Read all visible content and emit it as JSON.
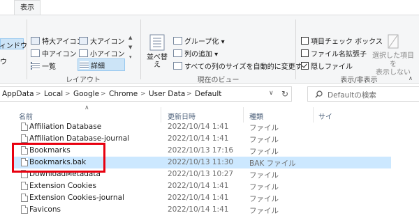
{
  "tabs": {
    "view": "表示"
  },
  "layout_group": {
    "items": [
      {
        "label": "特大アイコン",
        "icon": "extra-large-icons-icon"
      },
      {
        "label": "大アイコン",
        "icon": "large-icons-icon"
      },
      {
        "label": "中アイコン",
        "icon": "medium-icons-icon"
      },
      {
        "label": "小アイコン",
        "icon": "small-icons-icon"
      },
      {
        "label": "一覧",
        "icon": "list-view-icon"
      },
      {
        "label": "詳細",
        "icon": "details-view-icon"
      }
    ],
    "group_label": "レイアウト",
    "left_partial_top": "ィンドウ",
    "left_partial_bottom": "ウ"
  },
  "current_view_group": {
    "sort_label_1": "並べ替",
    "sort_label_2": "え",
    "group_by": "グループ化 ▾",
    "add_column": "列の追加 ▾",
    "fit_columns": "すべての列のサイズを自動的に変更する",
    "group_label": "現在のビュー"
  },
  "show_hide_group": {
    "item_checkboxes": "項目チェック ボックス",
    "file_extensions": "ファイル名拡張子",
    "hidden_files": "隠しファイル",
    "item_checkboxes_checked": false,
    "file_extensions_checked": false,
    "hidden_files_checked": true,
    "hide_selected_1": "選択した項目を",
    "hide_selected_2": "表示しない",
    "group_label": "表示/非表示"
  },
  "breadcrumb": [
    "AppData",
    "Local",
    "Google",
    "Chrome",
    "User Data",
    "Default"
  ],
  "search": {
    "placeholder": "Defaultの検索"
  },
  "columns": {
    "name": "名前",
    "date": "更新日時",
    "type": "種類",
    "size": "サイ"
  },
  "files": [
    {
      "name": "Affiliation Database",
      "date": "2022/10/14 1:41",
      "type": "ファイル"
    },
    {
      "name": "Affiliation Database-journal",
      "date": "2022/10/14 1:41",
      "type": "ファイル"
    },
    {
      "name": "Bookmarks",
      "date": "2022/10/13 17:16",
      "type": "ファイル"
    },
    {
      "name": "Bookmarks.bak",
      "date": "2022/10/13 11:30",
      "type": "BAK ファイル"
    },
    {
      "name": "DownloadMetadata",
      "date": "2022/10/13 10:27",
      "type": "ファイル"
    },
    {
      "name": "Extension Cookies",
      "date": "2022/10/14 1:41",
      "type": "ファイル"
    },
    {
      "name": "Extension Cookies-journal",
      "date": "2022/10/14 1:41",
      "type": "ファイル"
    },
    {
      "name": "Favicons",
      "date": "2022/10/14 1:41",
      "type": "ファイル"
    }
  ],
  "selected_file": "Bookmarks.bak",
  "colors": {
    "highlight": "#e8000f",
    "selection": "#cce8ff"
  }
}
